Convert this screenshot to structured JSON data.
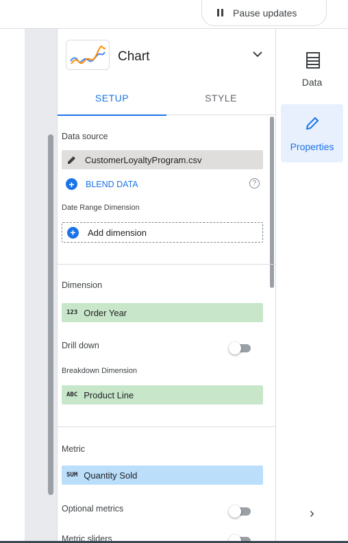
{
  "topbar": {
    "pause_label": "Pause updates"
  },
  "panel": {
    "chart_title": "Chart",
    "tabs": [
      {
        "label": "SETUP"
      },
      {
        "label": "STYLE"
      }
    ],
    "data_source": {
      "heading": "Data source",
      "file": "CustomerLoyaltyProgram.csv",
      "blend_label": "BLEND DATA"
    },
    "date_range": {
      "heading": "Date Range Dimension",
      "add_label": "Add dimension"
    },
    "dimension": {
      "heading": "Dimension",
      "type": "123",
      "value": "Order Year"
    },
    "drill_down": {
      "label": "Drill down",
      "enabled": false
    },
    "breakdown": {
      "heading": "Breakdown Dimension",
      "type": "ABC",
      "value": "Product Line"
    },
    "metric": {
      "heading": "Metric",
      "type": "SUM",
      "value": "Quantity Sold"
    },
    "optional_metrics": {
      "label": "Optional metrics",
      "enabled": false
    },
    "metric_sliders": {
      "label": "Metric sliders",
      "enabled": false
    }
  },
  "rail": {
    "data_label": "Data",
    "properties_label": "Properties",
    "chevron": "›"
  },
  "colors": {
    "accent": "#1a73e8",
    "dimension": "#c8e6c9",
    "metric": "#bbdefb",
    "source": "#e0dedd"
  }
}
